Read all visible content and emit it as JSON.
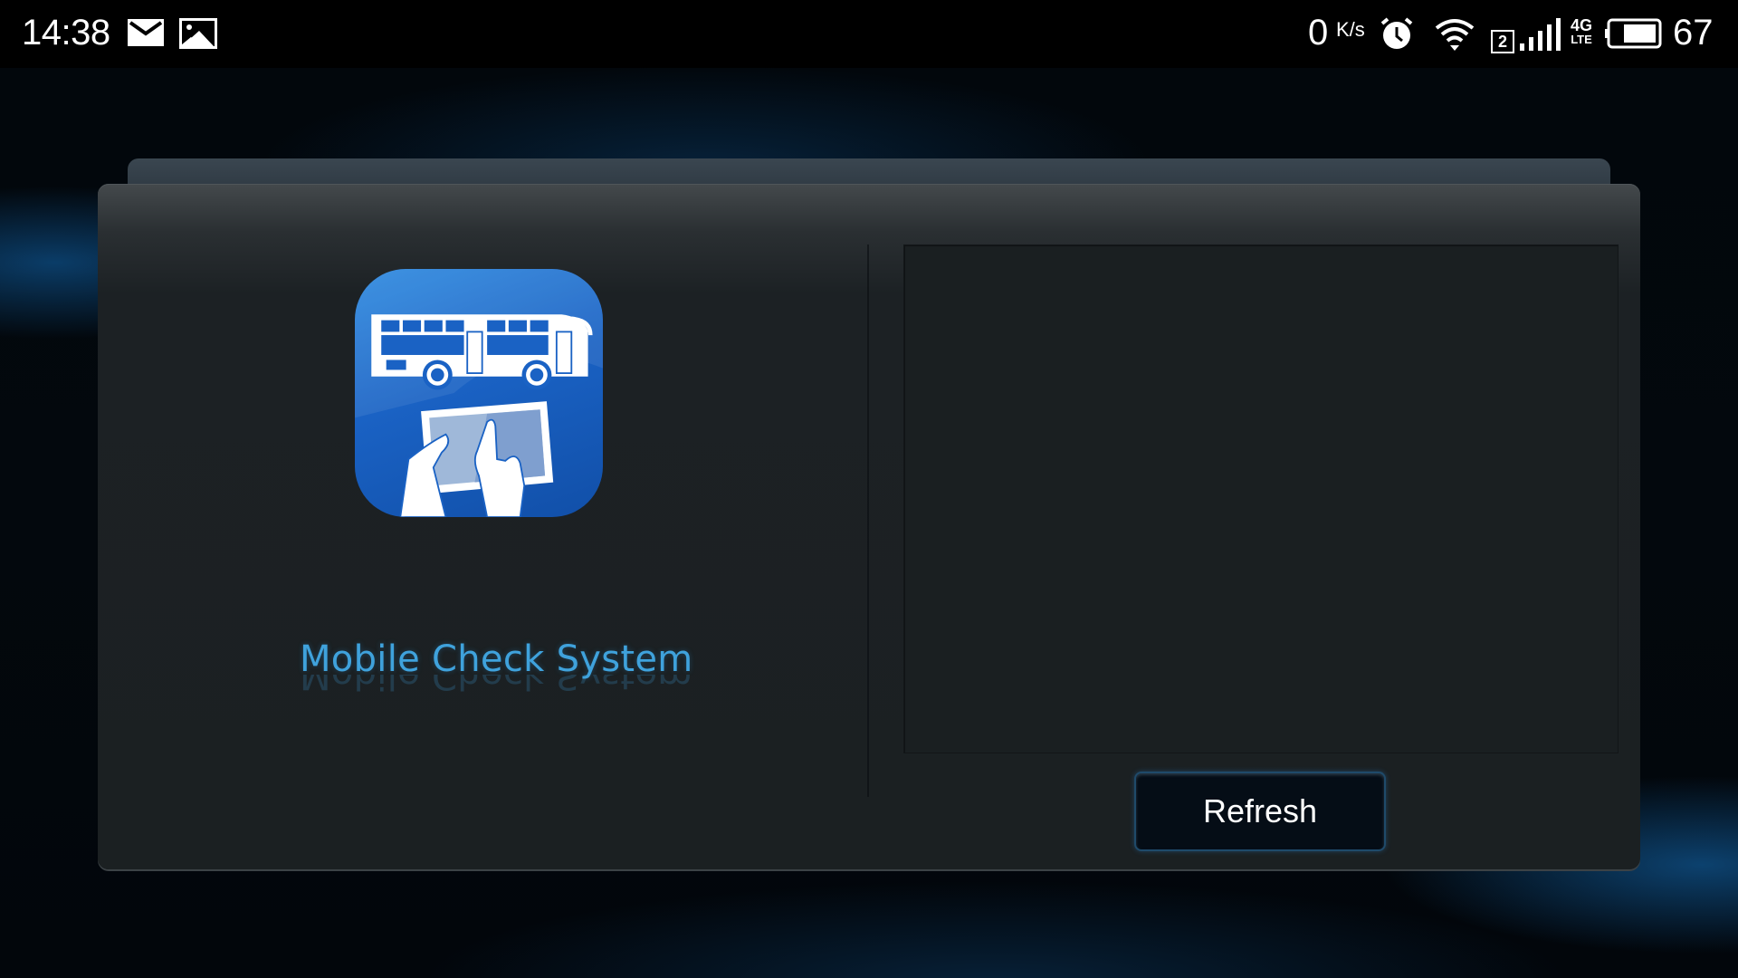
{
  "status_bar": {
    "time": "14:38",
    "left_icons": [
      "mail-icon",
      "image-icon"
    ],
    "net_speed_value": "0",
    "net_speed_unit": "K/s",
    "sim_slot": "2",
    "network_type_top": "4G",
    "network_type_bottom": "LTE",
    "battery_level": "67",
    "right_icons": [
      "alarm-icon",
      "wifi-icon",
      "sim-icon",
      "signal-icon",
      "network-type-icon",
      "battery-icon"
    ]
  },
  "app": {
    "name": "Mobile Check System",
    "icon": "bus-tablet-app-icon"
  },
  "actions": {
    "refresh_label": "Refresh"
  },
  "colors": {
    "accent": "#3fa2dc",
    "panel": "#1b2022",
    "button_bg": "#050d16"
  }
}
